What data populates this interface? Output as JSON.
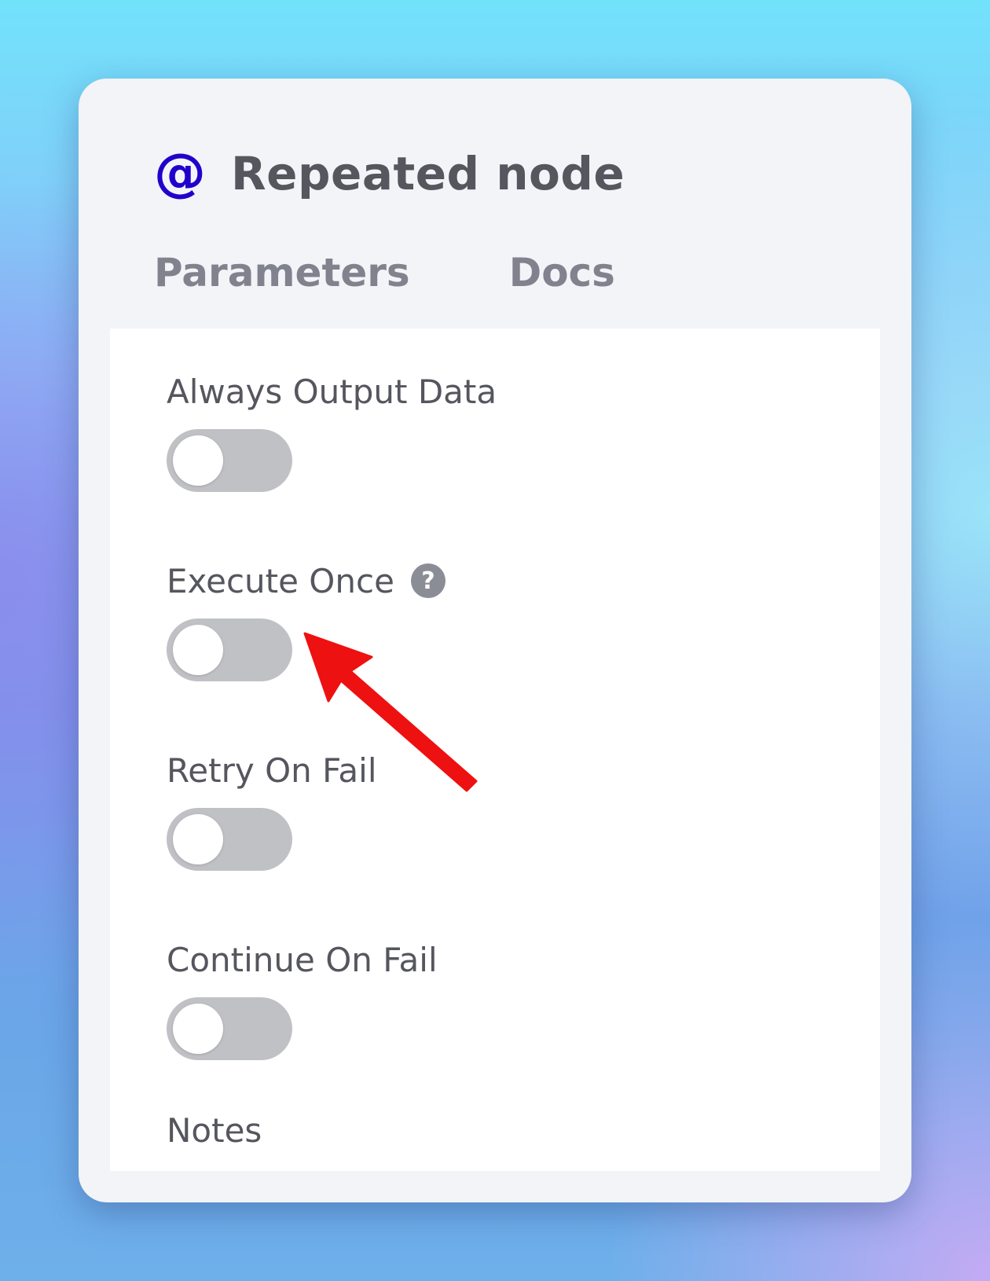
{
  "node": {
    "title": "Repeated node",
    "icon": "at-sign-icon",
    "icon_color": "#2200cc"
  },
  "tabs": [
    {
      "label": "Parameters"
    },
    {
      "label": "Docs"
    }
  ],
  "settings": [
    {
      "label": "Always Output Data",
      "enabled": false
    },
    {
      "label": "Execute Once",
      "enabled": false,
      "has_help": true
    },
    {
      "label": "Retry On Fail",
      "enabled": false
    },
    {
      "label": "Continue On Fail",
      "enabled": false
    }
  ],
  "notes": {
    "label": "Notes"
  },
  "annotation": {
    "type": "arrow",
    "color": "#ee1111",
    "points_to": "Execute Once toggle"
  }
}
